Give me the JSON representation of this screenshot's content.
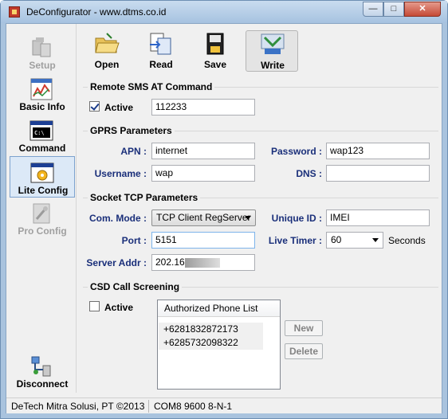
{
  "window": {
    "title": "DeConfigurator - www.dtms.co.id",
    "min_glyph": "—",
    "max_glyph": "□",
    "close_glyph": "✕"
  },
  "sidebar": {
    "items": [
      {
        "label": "Setup",
        "icon": "setup-icon",
        "enabled": false
      },
      {
        "label": "Basic Info",
        "icon": "chart-icon",
        "enabled": true
      },
      {
        "label": "Command",
        "icon": "console-icon",
        "enabled": true
      },
      {
        "label": "Lite Config",
        "icon": "gear-icon",
        "enabled": true,
        "selected": true
      },
      {
        "label": "Pro Config",
        "icon": "tools-icon",
        "enabled": false
      },
      {
        "label": "Disconnect",
        "icon": "network-icon",
        "enabled": true
      }
    ]
  },
  "toolbar": {
    "open": "Open",
    "read": "Read",
    "save": "Save",
    "write": "Write"
  },
  "sms": {
    "title": "Remote SMS AT Command",
    "active_label": "Active",
    "active": true,
    "value": "112233"
  },
  "gprs": {
    "title": "GPRS Parameters",
    "apn_label": "APN :",
    "apn": "internet",
    "password_label": "Password :",
    "password": "wap123",
    "username_label": "Username :",
    "username": "wap",
    "dns_label": "DNS :",
    "dns": ""
  },
  "tcp": {
    "title": "Socket TCP Parameters",
    "mode_label": "Com. Mode :",
    "mode": "TCP Client RegServer",
    "uid_label": "Unique ID :",
    "uid": "IMEI",
    "port_label": "Port :",
    "port": "5151",
    "timer_label": "Live Timer :",
    "timer": "60",
    "timer_unit": "Seconds",
    "server_label": "Server Addr :",
    "server": "202.16"
  },
  "csd": {
    "title": "CSD Call Screening",
    "active_label": "Active",
    "active": false,
    "list_header": "Authorized Phone List",
    "phones": [
      "+6281832872173",
      "+6285732098322"
    ],
    "new_label": "New",
    "delete_label": "Delete"
  },
  "status": {
    "company": "DeTech Mitra Solusi, PT ©2013",
    "port": "COM8 9600 8-N-1"
  }
}
